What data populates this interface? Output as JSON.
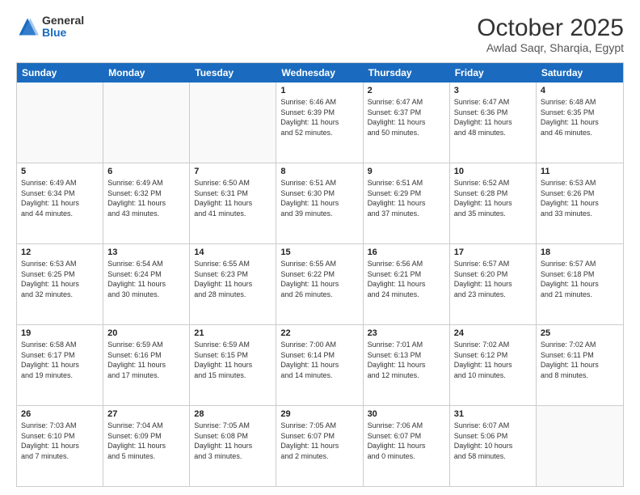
{
  "logo": {
    "general": "General",
    "blue": "Blue"
  },
  "header": {
    "month": "October 2025",
    "location": "Awlad Saqr, Sharqia, Egypt"
  },
  "days": [
    "Sunday",
    "Monday",
    "Tuesday",
    "Wednesday",
    "Thursday",
    "Friday",
    "Saturday"
  ],
  "rows": [
    [
      {
        "num": "",
        "text": ""
      },
      {
        "num": "",
        "text": ""
      },
      {
        "num": "",
        "text": ""
      },
      {
        "num": "1",
        "text": "Sunrise: 6:46 AM\nSunset: 6:39 PM\nDaylight: 11 hours\nand 52 minutes."
      },
      {
        "num": "2",
        "text": "Sunrise: 6:47 AM\nSunset: 6:37 PM\nDaylight: 11 hours\nand 50 minutes."
      },
      {
        "num": "3",
        "text": "Sunrise: 6:47 AM\nSunset: 6:36 PM\nDaylight: 11 hours\nand 48 minutes."
      },
      {
        "num": "4",
        "text": "Sunrise: 6:48 AM\nSunset: 6:35 PM\nDaylight: 11 hours\nand 46 minutes."
      }
    ],
    [
      {
        "num": "5",
        "text": "Sunrise: 6:49 AM\nSunset: 6:34 PM\nDaylight: 11 hours\nand 44 minutes."
      },
      {
        "num": "6",
        "text": "Sunrise: 6:49 AM\nSunset: 6:32 PM\nDaylight: 11 hours\nand 43 minutes."
      },
      {
        "num": "7",
        "text": "Sunrise: 6:50 AM\nSunset: 6:31 PM\nDaylight: 11 hours\nand 41 minutes."
      },
      {
        "num": "8",
        "text": "Sunrise: 6:51 AM\nSunset: 6:30 PM\nDaylight: 11 hours\nand 39 minutes."
      },
      {
        "num": "9",
        "text": "Sunrise: 6:51 AM\nSunset: 6:29 PM\nDaylight: 11 hours\nand 37 minutes."
      },
      {
        "num": "10",
        "text": "Sunrise: 6:52 AM\nSunset: 6:28 PM\nDaylight: 11 hours\nand 35 minutes."
      },
      {
        "num": "11",
        "text": "Sunrise: 6:53 AM\nSunset: 6:26 PM\nDaylight: 11 hours\nand 33 minutes."
      }
    ],
    [
      {
        "num": "12",
        "text": "Sunrise: 6:53 AM\nSunset: 6:25 PM\nDaylight: 11 hours\nand 32 minutes."
      },
      {
        "num": "13",
        "text": "Sunrise: 6:54 AM\nSunset: 6:24 PM\nDaylight: 11 hours\nand 30 minutes."
      },
      {
        "num": "14",
        "text": "Sunrise: 6:55 AM\nSunset: 6:23 PM\nDaylight: 11 hours\nand 28 minutes."
      },
      {
        "num": "15",
        "text": "Sunrise: 6:55 AM\nSunset: 6:22 PM\nDaylight: 11 hours\nand 26 minutes."
      },
      {
        "num": "16",
        "text": "Sunrise: 6:56 AM\nSunset: 6:21 PM\nDaylight: 11 hours\nand 24 minutes."
      },
      {
        "num": "17",
        "text": "Sunrise: 6:57 AM\nSunset: 6:20 PM\nDaylight: 11 hours\nand 23 minutes."
      },
      {
        "num": "18",
        "text": "Sunrise: 6:57 AM\nSunset: 6:18 PM\nDaylight: 11 hours\nand 21 minutes."
      }
    ],
    [
      {
        "num": "19",
        "text": "Sunrise: 6:58 AM\nSunset: 6:17 PM\nDaylight: 11 hours\nand 19 minutes."
      },
      {
        "num": "20",
        "text": "Sunrise: 6:59 AM\nSunset: 6:16 PM\nDaylight: 11 hours\nand 17 minutes."
      },
      {
        "num": "21",
        "text": "Sunrise: 6:59 AM\nSunset: 6:15 PM\nDaylight: 11 hours\nand 15 minutes."
      },
      {
        "num": "22",
        "text": "Sunrise: 7:00 AM\nSunset: 6:14 PM\nDaylight: 11 hours\nand 14 minutes."
      },
      {
        "num": "23",
        "text": "Sunrise: 7:01 AM\nSunset: 6:13 PM\nDaylight: 11 hours\nand 12 minutes."
      },
      {
        "num": "24",
        "text": "Sunrise: 7:02 AM\nSunset: 6:12 PM\nDaylight: 11 hours\nand 10 minutes."
      },
      {
        "num": "25",
        "text": "Sunrise: 7:02 AM\nSunset: 6:11 PM\nDaylight: 11 hours\nand 8 minutes."
      }
    ],
    [
      {
        "num": "26",
        "text": "Sunrise: 7:03 AM\nSunset: 6:10 PM\nDaylight: 11 hours\nand 7 minutes."
      },
      {
        "num": "27",
        "text": "Sunrise: 7:04 AM\nSunset: 6:09 PM\nDaylight: 11 hours\nand 5 minutes."
      },
      {
        "num": "28",
        "text": "Sunrise: 7:05 AM\nSunset: 6:08 PM\nDaylight: 11 hours\nand 3 minutes."
      },
      {
        "num": "29",
        "text": "Sunrise: 7:05 AM\nSunset: 6:07 PM\nDaylight: 11 hours\nand 2 minutes."
      },
      {
        "num": "30",
        "text": "Sunrise: 7:06 AM\nSunset: 6:07 PM\nDaylight: 11 hours\nand 0 minutes."
      },
      {
        "num": "31",
        "text": "Sunrise: 6:07 AM\nSunset: 5:06 PM\nDaylight: 10 hours\nand 58 minutes."
      },
      {
        "num": "",
        "text": ""
      }
    ]
  ]
}
